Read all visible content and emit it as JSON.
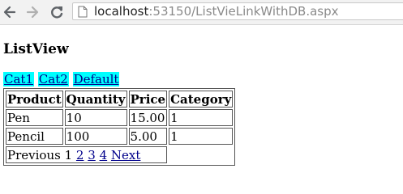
{
  "browser": {
    "url_host": "localhost",
    "url_rest": ":53150/ListVieLinkWithDB.aspx"
  },
  "page": {
    "title": "ListView"
  },
  "filters": [
    "Cat1",
    "Cat2",
    "Default"
  ],
  "table": {
    "headers": [
      "Product",
      "Quantity",
      "Price",
      "Category"
    ],
    "rows": [
      [
        "Pen",
        "10",
        "15.00",
        "1"
      ],
      [
        "Pencil",
        "100",
        "5.00",
        "1"
      ]
    ]
  },
  "pager": {
    "previous": "Previous",
    "current": "1",
    "pages": [
      "2",
      "3",
      "4"
    ],
    "next": "Next"
  },
  "colors": {
    "link": "#00008b",
    "link_highlight": "#00ffff"
  },
  "icons": [
    "back-arrow-icon",
    "forward-arrow-icon",
    "reload-icon",
    "page-icon"
  ]
}
